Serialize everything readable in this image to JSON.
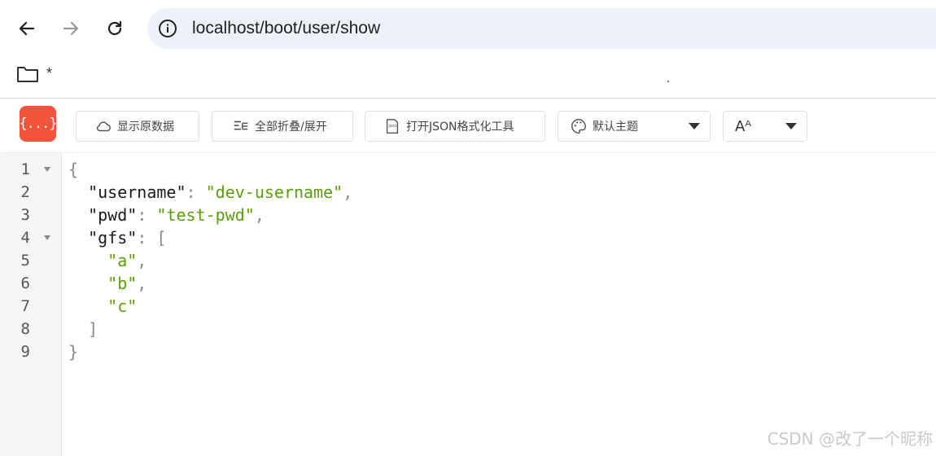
{
  "browser": {
    "url": "localhost/boot/user/show",
    "bookmark_label": "*"
  },
  "toolbar": {
    "logo_text": "{...}",
    "raw_button": "显示原数据",
    "fold_button": "全部折叠/展开",
    "json_tool_button": "打开JSON格式化工具",
    "theme_select": "默认主题",
    "font_select": "Aᴬ"
  },
  "colors": {
    "logo_bg": "#f1533b",
    "string_color": "#5c9d0d",
    "active_line": "#e8f2fe",
    "address_bar": "#edf2fa"
  },
  "code": {
    "line_numbers": [
      "1",
      "2",
      "3",
      "4",
      "5",
      "6",
      "7",
      "8",
      "9"
    ],
    "lines": [
      {
        "indent": "",
        "text": "{"
      },
      {
        "indent": "  ",
        "key": "\"username\"",
        "colon": ": ",
        "value": "\"dev-username\"",
        "trail": ","
      },
      {
        "indent": "  ",
        "key": "\"pwd\"",
        "colon": ": ",
        "value": "\"test-pwd\"",
        "trail": ","
      },
      {
        "indent": "  ",
        "key": "\"gfs\"",
        "colon": ": ",
        "text": "["
      },
      {
        "indent": "    ",
        "value": "\"a\"",
        "trail": ","
      },
      {
        "indent": "    ",
        "value": "\"b\"",
        "trail": ","
      },
      {
        "indent": "    ",
        "value": "\"c\""
      },
      {
        "indent": "  ",
        "text": "]"
      },
      {
        "indent": "",
        "text": "}"
      }
    ]
  },
  "watermark": "CSDN @改了一个昵称"
}
